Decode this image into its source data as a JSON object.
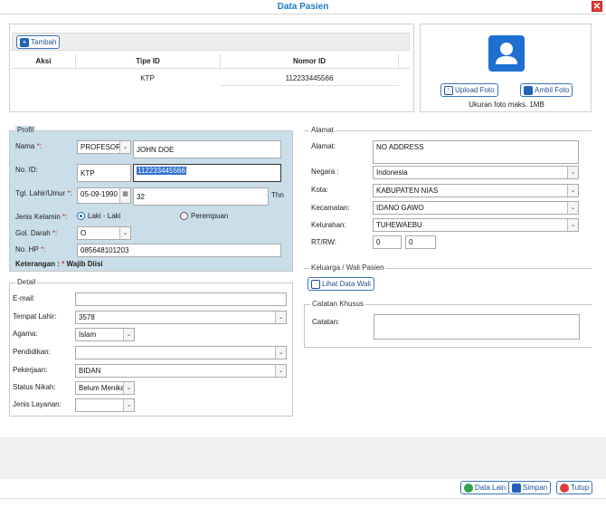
{
  "window": {
    "title": "Data Pasien",
    "close_label": "✕"
  },
  "id_table": {
    "add_label": "Tambah",
    "headers": [
      "Aksi",
      "Tipe ID",
      "Nomor ID"
    ],
    "rows": [
      {
        "aksi": "",
        "tipe": "KTP",
        "nomor": "112233445566"
      }
    ]
  },
  "photo": {
    "upload_label": "Upload Foto",
    "take_label": "Ambil Foto",
    "note": "Ukuran foto maks. 1MB"
  },
  "profil": {
    "legend": "Profil",
    "nama_label": "Nama",
    "gelar_value": "PROFESOR",
    "nama_value": "JOHN DOE",
    "noid_label": "No. ID:",
    "noid_type": "KTP",
    "noid_value": "112233445566",
    "ttl_label": "Tgl. Lahir/Umur",
    "ttl_date": "05-09-1990",
    "ttl_age": "32",
    "ttl_unit": "Thn",
    "jk_label": "Jenis Kelamin",
    "jk_options": [
      "Laki - Laki",
      "Perempuan"
    ],
    "jk_selected": "Laki - Laki",
    "gol_label": "Gol. Darah",
    "gol_value": "O",
    "hp_label": "No. HP",
    "hp_value": "085648101203",
    "keterangan_label": "Keterangan :",
    "keterangan_text": "Wajib Diisi",
    "required_mark": "*",
    "colon": ":"
  },
  "alamat": {
    "legend": "Alamat",
    "alamat_label": "Alamat:",
    "alamat_value": "NO ADDRESS",
    "negara_label": "Negara :",
    "negara_value": "Indonesia",
    "kota_label": "Kota:",
    "kota_value": "KABUPATEN NIAS",
    "kecamatan_label": "Kecamatan:",
    "kecamatan_value": "IDANO GAWO",
    "kelurahan_label": "Kelurahan:",
    "kelurahan_value": "TUHEWAEBU",
    "rtrw_label": "RT/RW:",
    "rt_value": "0",
    "rw_value": "0"
  },
  "keluarga": {
    "legend": "Keluarga / Wali Pasien",
    "button_label": "Lihat Data Wali"
  },
  "catatan": {
    "legend": "Catatan Khusus",
    "label": "Catatan:",
    "value": ""
  },
  "detail": {
    "legend": "Detail",
    "email_label": "E-mail:",
    "email_value": "",
    "tempat_label": "Tempat Lahir:",
    "tempat_value": "3578",
    "agama_label": "Agama:",
    "agama_value": "Islam",
    "pendidikan_label": "Pendidikan:",
    "pendidikan_value": "",
    "pekerjaan_label": "Pekerjaan:",
    "pekerjaan_value": "BIDAN",
    "status_label": "Status Nikah:",
    "status_value": "Belum Menikah",
    "layanan_label": "Jenis Layanan:",
    "layanan_value": ""
  },
  "footer": {
    "data_lain_label": "Data Lain",
    "simpan_label": "Simpan",
    "tutup_label": "Tutup"
  },
  "colors": {
    "accent": "#1a7ac7",
    "profile_bg": "#c9dee9",
    "close": "#e03b3b"
  }
}
